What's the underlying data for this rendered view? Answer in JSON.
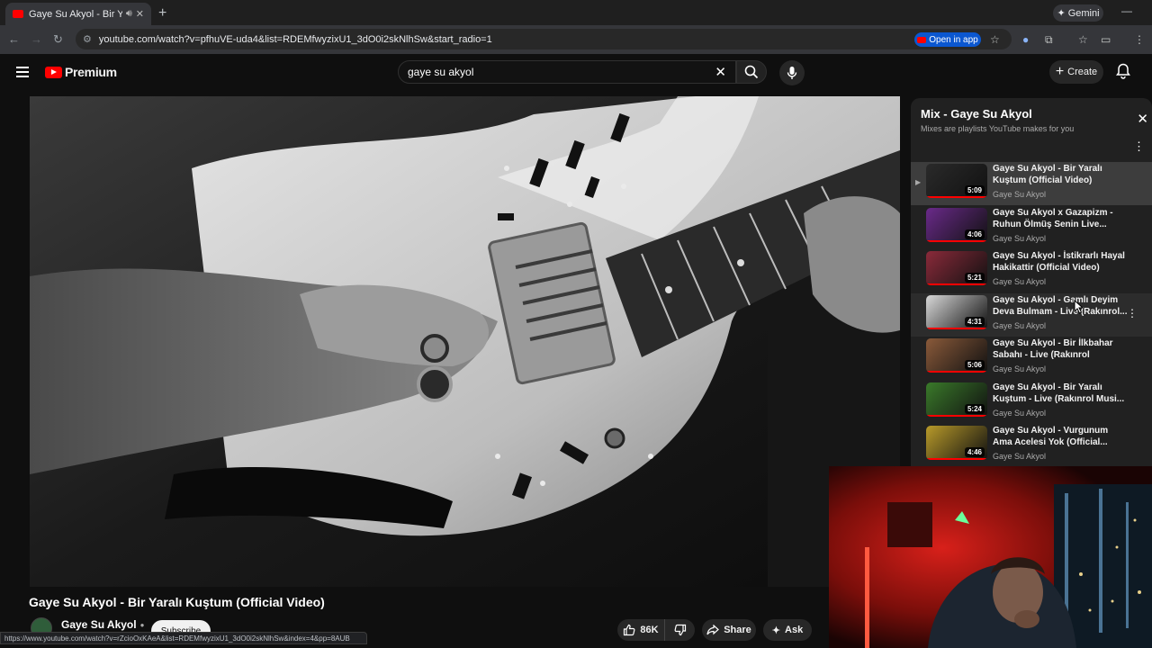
{
  "browser": {
    "tab_title": "Gaye Su Akyol - Bir Yaralı K",
    "sound_icon": "speaker-icon",
    "new_tab_symbol": "+",
    "gemini_label": "Gemini",
    "url": "youtube.com/watch?v=pfhuVE-uda4&list=RDEMfwyzixU1_3dO0i2skNlhSw&start_radio=1",
    "open_in_app_label": "Open in app",
    "status_url": "https://www.youtube.com/watch?v=rZcioOxKAeA&list=RDEMfwyzixU1_3dO0i2skNlhSw&index=4&pp=8AUB"
  },
  "header": {
    "brand_label": "Premium",
    "search_value": "gaye su akyol",
    "create_label": "Create"
  },
  "video": {
    "title": "Gaye Su Akyol - Bir Yaralı Kuştum (Official Video)",
    "channel_name": "Gaye Su Akyol",
    "subscribe_label": "Subscribe",
    "likes_label": "86K",
    "share_label": "Share",
    "ask_label": "Ask"
  },
  "playlist": {
    "title": "Mix - Gaye Su Akyol",
    "subtitle": "Mixes are playlists YouTube makes for you",
    "items": [
      {
        "title": "Gaye Su Akyol - Bir Yaralı Kuştum (Official Video)",
        "artist": "Gaye Su Akyol",
        "duration": "5:09",
        "thumb_color": "#2a2a2a"
      },
      {
        "title": "Gaye Su Akyol x Gazapizm - Ruhun Ölmüş Senin Live...",
        "artist": "Gaye Su Akyol",
        "duration": "4:06",
        "thumb_color": "#6a2a8a"
      },
      {
        "title": "Gaye Su Akyol - İstikrarlı Hayal Hakikattir (Official Video)",
        "artist": "Gaye Su Akyol",
        "duration": "5:21",
        "thumb_color": "#8a2a3a"
      },
      {
        "title": "Gaye Su Akyol - Gamlı Deyim Deva Bulmam - Live (Rakınrol...",
        "artist": "Gaye Su Akyol",
        "duration": "4:31",
        "thumb_color": "#d8d8d8"
      },
      {
        "title": "Gaye Su Akyol - Bir İlkbahar Sabahı - Live (Rakınrol Musiki...",
        "artist": "Gaye Su Akyol",
        "duration": "5:06",
        "thumb_color": "#8a5a3a"
      },
      {
        "title": "Gaye Su Akyol - Bir Yaralı Kuştum - Live (Rakınrol Musi...",
        "artist": "Gaye Su Akyol",
        "duration": "5:24",
        "thumb_color": "#3a7a2a"
      },
      {
        "title": "Gaye Su Akyol - Vurgunum Ama Acelesi Yok (Official...",
        "artist": "Gaye Su Akyol",
        "duration": "4:46",
        "thumb_color": "#b89a2a"
      }
    ]
  }
}
